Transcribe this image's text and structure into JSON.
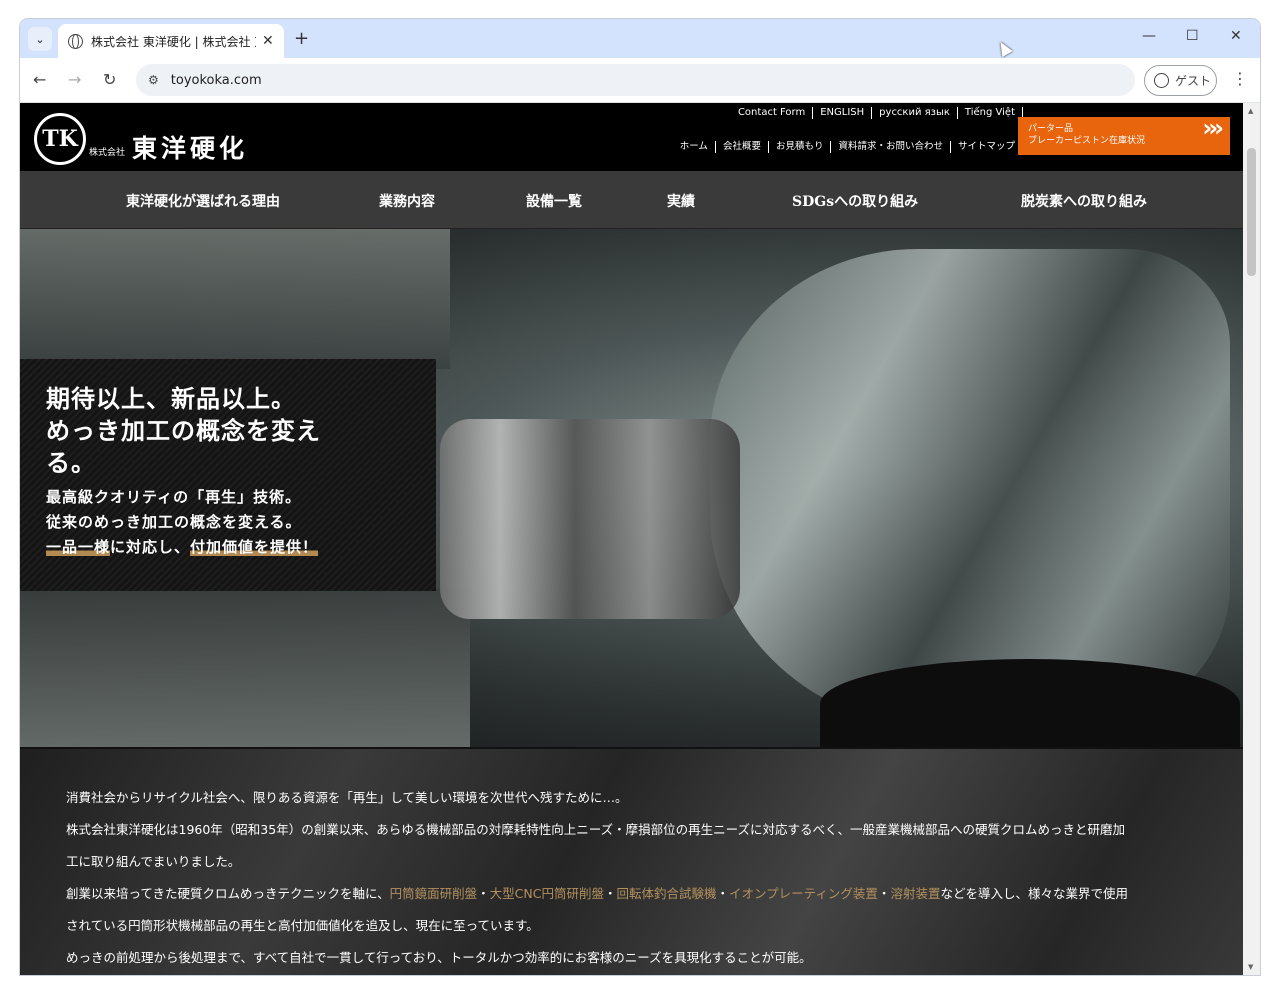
{
  "browser": {
    "tab_title": "株式会社 東洋硬化 | 株式会社 東",
    "url": "toyokoka.com",
    "profile": "ゲスト",
    "new_tab": "+",
    "tab_close": "✕",
    "list_btn": "⌄",
    "minimize": "—",
    "maximize": "☐",
    "close": "✕",
    "back": "←",
    "forward": "→",
    "reload": "↻",
    "menu": "⋮",
    "site_info": "⚙"
  },
  "header": {
    "logo_text": "TK",
    "kk": "株式会社",
    "company": "東洋硬化",
    "top_links": [
      "Contact Form",
      "ENGLISH",
      "русский язык",
      "Tiếng Việt"
    ],
    "sub_links": [
      "ホーム",
      "会社概要",
      "お見積もり",
      "資料請求・お問い合わせ",
      "サイトマップ"
    ],
    "banner_line1": "パーター品",
    "banner_line2": "ブレーカーピストン在庫状況",
    "banner_arrow": "›››"
  },
  "gnav": [
    "東洋硬化が選ばれる理由",
    "業務内容",
    "設備一覧",
    "実績",
    "SDGsへの取り組み",
    "脱炭素への取り組み"
  ],
  "hero": {
    "h1": "期待以上、新品以上。",
    "h2": "めっき加工の概念を変え",
    "h3": "る。",
    "s1": "最高級クオリティの「再生」技術。",
    "s2": "従来のめっき加工の概念を変える。",
    "s3a": "一品一様",
    "s3b": "に対応し、",
    "s3c": "付加価値を提供！"
  },
  "intro": {
    "p1": "消費社会からリサイクル社会へ、限りある資源を「再生」して美しい環境を次世代へ残すために…。",
    "p2": "株式会社東洋硬化は1960年（昭和35年）の創業以来、あらゆる機械部品の対摩耗特性向上ニーズ・摩損部位の再生ニーズに対応するべく、一般産業機械部品への硬質クロムめっきと研磨加",
    "p3": "工に取り組んでまいりました。",
    "p4a": "創業以来培ってきた硬質クロムめっきテクニックを軸に、",
    "l1": "円筒鏡面研削盤",
    "sep": "・",
    "l2": "大型CNC円筒研削盤",
    "l3": "回転体釣合試験機",
    "l4": "イオンプレーティング装置",
    "l5": "溶射装置",
    "p4b": "などを導入し、様々な業界で使用",
    "p5": "されている円筒形状機械部品の再生と高付加価値化を追及し、現在に至っています。",
    "p6": "めっきの前処理から後処理まで、すべて自社で一貫して行っており、トータルかつ効率的にお客様のニーズを具現化することが可能。"
  }
}
